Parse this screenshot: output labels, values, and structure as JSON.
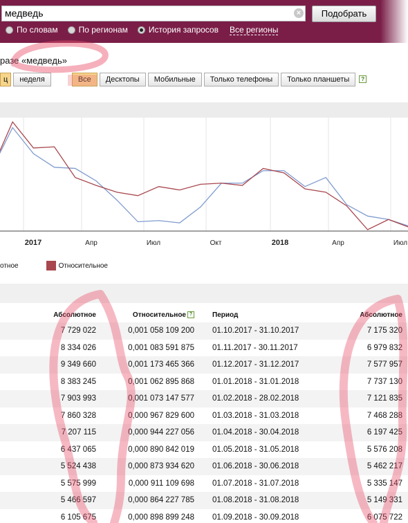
{
  "search": {
    "query": "медведь",
    "submit_label": "Подобрать",
    "modes": [
      {
        "label": "По словам",
        "selected": false
      },
      {
        "label": "По регионам",
        "selected": false
      },
      {
        "label": "История запросов",
        "selected": true
      }
    ],
    "regions_link": "Все регионы"
  },
  "title": "разе «медведь»",
  "filters": {
    "period_partial": "ц",
    "period_week": "неделя",
    "devices": [
      {
        "label": "Все",
        "active": true
      },
      {
        "label": "Десктопы",
        "active": false
      },
      {
        "label": "Мобильные",
        "active": false
      },
      {
        "label": "Только телефоны",
        "active": false
      },
      {
        "label": "Только планшеты",
        "active": false
      }
    ],
    "help_label": "?"
  },
  "chart_data": {
    "type": "line",
    "x_tick_labels": [
      "2017",
      "Апр",
      "Июл",
      "Окт",
      "2018",
      "Апр",
      "Июл"
    ],
    "x_tick_bold": [
      true,
      false,
      false,
      false,
      true,
      false,
      false
    ],
    "series": [
      {
        "name": "Абсолютное",
        "color": "#7f9ccf",
        "values": [
          0.53,
          0.9,
          0.67,
          0.55,
          0.54,
          0.43,
          0.26,
          0.07,
          0.08,
          0.06,
          0.2,
          0.41,
          0.41,
          0.52,
          0.52,
          0.38,
          0.46,
          0.22,
          0.12,
          0.09,
          0.03
        ]
      },
      {
        "name": "Относительное",
        "color": "#a8474e",
        "values": [
          0.53,
          0.95,
          0.72,
          0.73,
          0.46,
          0.39,
          0.33,
          0.3,
          0.38,
          0.35,
          0.4,
          0.41,
          0.39,
          0.54,
          0.5,
          0.36,
          0.33,
          0.21,
          0.0,
          0.09,
          0.02
        ]
      }
    ],
    "legend": [
      {
        "label": "отное"
      },
      {
        "label": "Относительное",
        "color": "#a8474e"
      }
    ]
  },
  "table": {
    "headers": {
      "abs": "Абсолютное",
      "rel": "Относительное",
      "period": "Период",
      "abs2": "Абсолютное",
      "help": "?"
    },
    "rows": [
      {
        "abs": "7 729 022",
        "rel": "0,001 058 109 200",
        "period": "01.10.2017 - 31.10.2017",
        "abs2": "7 175 320"
      },
      {
        "abs": "8 334 026",
        "rel": "0,001 083 591 875",
        "period": "01.11.2017 - 30.11.2017",
        "abs2": "6 979 832"
      },
      {
        "abs": "9 349 660",
        "rel": "0,001 173 465 366",
        "period": "01.12.2017 - 31.12.2017",
        "abs2": "7 577 957"
      },
      {
        "abs": "8 383 245",
        "rel": "0,001 062 895 868",
        "period": "01.01.2018 - 31.01.2018",
        "abs2": "7 737 130"
      },
      {
        "abs": "7 903 993",
        "rel": "0,001 073 147 577",
        "period": "01.02.2018 - 28.02.2018",
        "abs2": "7 121 835"
      },
      {
        "abs": "7 860 328",
        "rel": "0,000 967 829 600",
        "period": "01.03.2018 - 31.03.2018",
        "abs2": "7 468 288"
      },
      {
        "abs": "7 207 115",
        "rel": "0,000 944 227 056",
        "period": "01.04.2018 - 30.04.2018",
        "abs2": "6 197 425"
      },
      {
        "abs": "6 437 065",
        "rel": "0,000 890 842 019",
        "period": "01.05.2018 - 31.05.2018",
        "abs2": "5 576 208"
      },
      {
        "abs": "5 524 438",
        "rel": "0,000 873 934 620",
        "period": "01.06.2018 - 30.06.2018",
        "abs2": "5 462 217"
      },
      {
        "abs": "5 575 999",
        "rel": "0,000 911 109 698",
        "period": "01.07.2018 - 31.07.2018",
        "abs2": "5 335 147"
      },
      {
        "abs": "5 466 597",
        "rel": "0,000 864 227 785",
        "period": "01.08.2018 - 31.08.2018",
        "abs2": "5 149 331"
      },
      {
        "abs": "6 105 675",
        "rel": "0,000 898 899 248",
        "period": "01.09.2018 - 30.09.2018",
        "abs2": "6 075 722"
      }
    ]
  },
  "colors": {
    "header_bg": "#7a1e48",
    "annotation": "#e8506a",
    "active_filter": "#f6d58a"
  }
}
